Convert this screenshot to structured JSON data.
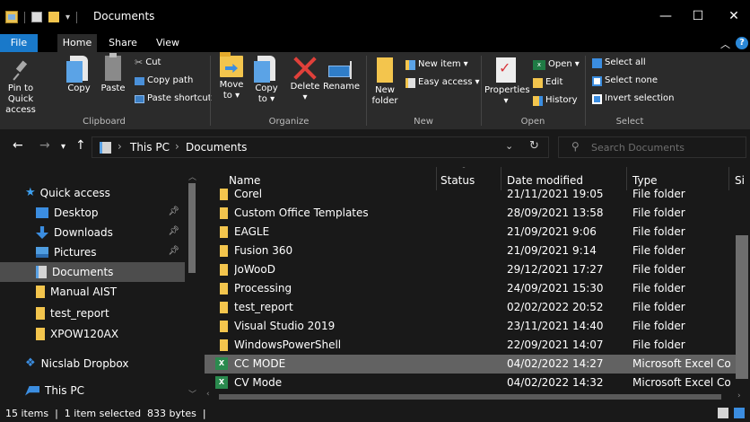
{
  "window": {
    "title": "Documents",
    "minimize": "—",
    "maximize": "☐",
    "close": "✕"
  },
  "ribbon_tabs": [
    {
      "label": "File"
    },
    {
      "label": "Home"
    },
    {
      "label": "Share"
    },
    {
      "label": "View"
    }
  ],
  "ribbon": {
    "clipboard": {
      "pin": "Pin to Quick access",
      "copy": "Copy",
      "paste": "Paste",
      "cut": "Cut",
      "copy_path": "Copy path",
      "paste_shortcut": "Paste shortcut",
      "label": "Clipboard"
    },
    "organize": {
      "move_to": "Move to",
      "copy_to": "Copy to",
      "delete": "Delete",
      "rename": "Rename",
      "label": "Organize"
    },
    "new": {
      "new_folder": "New folder",
      "new_item": "New item",
      "easy_access": "Easy access",
      "label": "New"
    },
    "open": {
      "properties": "Properties",
      "open": "Open",
      "edit": "Edit",
      "history": "History",
      "label": "Open"
    },
    "select": {
      "select_all": "Select all",
      "select_none": "Select none",
      "invert_selection": "Invert selection",
      "label": "Select"
    }
  },
  "address": {
    "crumbs": [
      "This PC",
      "Documents"
    ],
    "search_placeholder": "Search Documents"
  },
  "nav_pane": [
    {
      "label": "Quick access",
      "icon": "star-icon",
      "pinned": false
    },
    {
      "label": "Desktop",
      "icon": "desktop-icon",
      "pinned": true
    },
    {
      "label": "Downloads",
      "icon": "download-icon",
      "pinned": true
    },
    {
      "label": "Pictures",
      "icon": "pictures-icon",
      "pinned": true
    },
    {
      "label": "Documents",
      "icon": "documents-icon",
      "pinned": false,
      "selected": true
    },
    {
      "label": "Manual AIST",
      "icon": "folder-icon",
      "pinned": false
    },
    {
      "label": "test_report",
      "icon": "folder-icon",
      "pinned": false
    },
    {
      "label": "XPOW120AX",
      "icon": "folder-icon",
      "pinned": false
    },
    {
      "label": "Nicslab Dropbox",
      "icon": "dropbox-icon",
      "pinned": false
    },
    {
      "label": "This PC",
      "icon": "pc-icon",
      "pinned": false
    }
  ],
  "columns": {
    "name": "Name",
    "status": "Status",
    "date": "Date modified",
    "type": "Type",
    "size": "Si"
  },
  "files": [
    {
      "name": "Corel",
      "date": "21/11/2021 19:05",
      "type": "File folder",
      "kind": "folder"
    },
    {
      "name": "Custom Office Templates",
      "date": "28/09/2021 13:58",
      "type": "File folder",
      "kind": "folder"
    },
    {
      "name": "EAGLE",
      "date": "21/09/2021 9:06",
      "type": "File folder",
      "kind": "folder"
    },
    {
      "name": "Fusion 360",
      "date": "21/09/2021 9:14",
      "type": "File folder",
      "kind": "folder"
    },
    {
      "name": "JoWooD",
      "date": "29/12/2021 17:27",
      "type": "File folder",
      "kind": "folder"
    },
    {
      "name": "Processing",
      "date": "24/09/2021 15:30",
      "type": "File folder",
      "kind": "folder"
    },
    {
      "name": "test_report",
      "date": "02/02/2022 20:52",
      "type": "File folder",
      "kind": "folder"
    },
    {
      "name": "Visual Studio 2019",
      "date": "23/11/2021 14:40",
      "type": "File folder",
      "kind": "folder"
    },
    {
      "name": "WindowsPowerShell",
      "date": "22/09/2021 14:07",
      "type": "File folder",
      "kind": "folder"
    },
    {
      "name": "CC MODE",
      "date": "04/02/2022 14:27",
      "type": "Microsoft Excel Co...",
      "kind": "excel",
      "selected": true
    },
    {
      "name": "CV Mode",
      "date": "04/02/2022 14:32",
      "type": "Microsoft Excel Co...",
      "kind": "excel"
    }
  ],
  "status_bar": {
    "text": "15 items  |  1 item selected  833 bytes  |"
  },
  "colors": {
    "background": "#191919",
    "ribbon": "#2b2b2b",
    "file_tab": "#1979ca",
    "folder": "#f3c54d",
    "selection": "#626262",
    "accent": "#3b8de0"
  }
}
